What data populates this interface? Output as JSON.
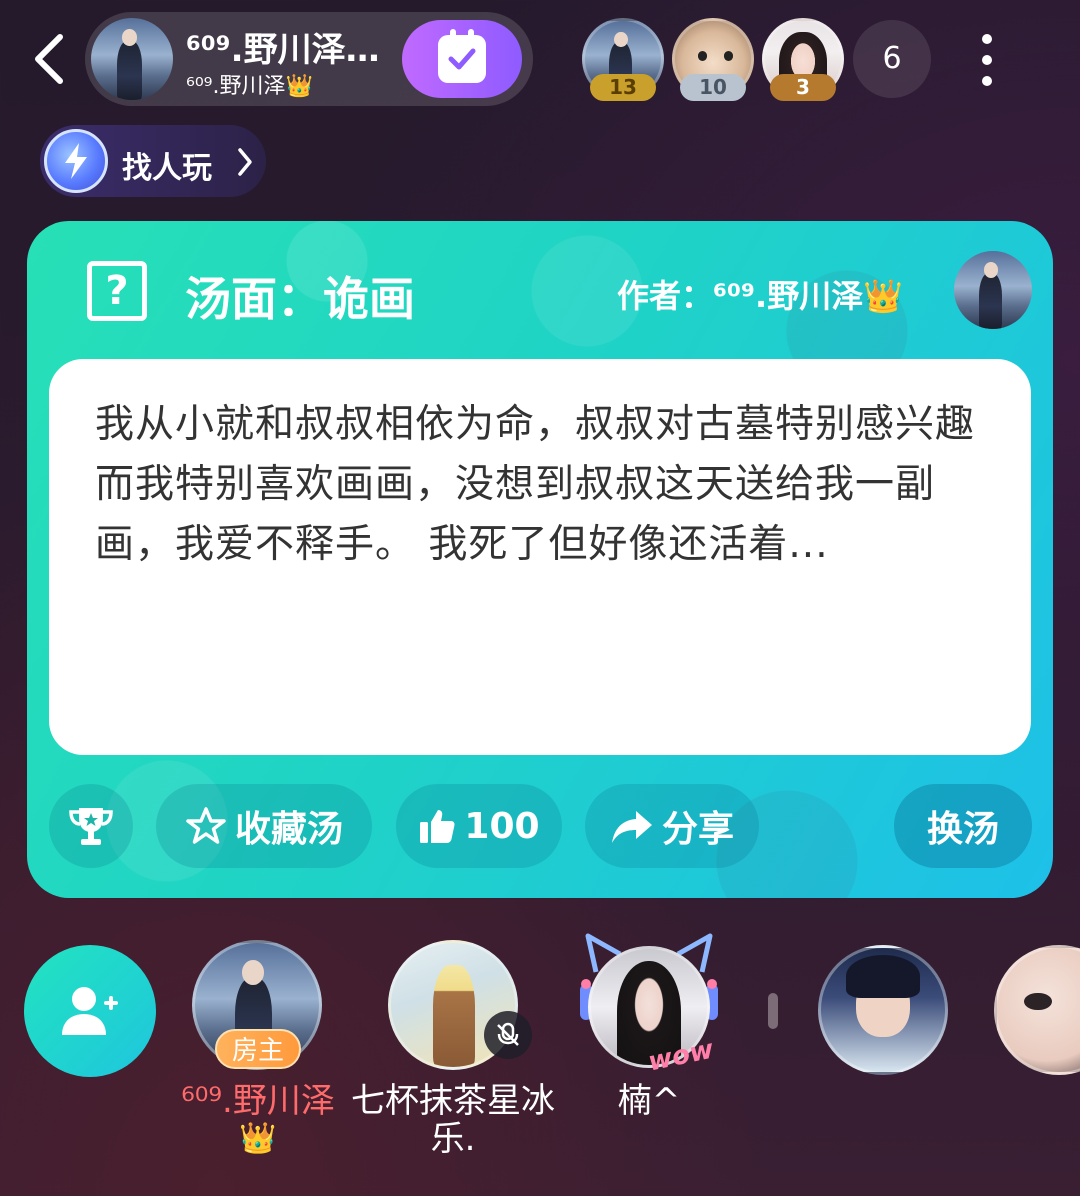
{
  "header": {
    "room_title": "⁶⁰⁹.野川泽…",
    "room_owner": "⁶⁰⁹.野川泽👑",
    "online_count": "6",
    "rank": [
      {
        "avatar": "man-avatar",
        "score": "13",
        "tier": "gold"
      },
      {
        "avatar": "hamster-avatar",
        "score": "10",
        "tier": "silver"
      },
      {
        "avatar": "girl-avatar",
        "score": "3",
        "tier": "bronze"
      }
    ]
  },
  "find_play": {
    "label": "找人玩"
  },
  "soup": {
    "title": "汤面：诡画",
    "author": "作者：⁶⁰⁹.野川泽👑",
    "text": "我从小就和叔叔相依为命，叔叔对古墓特别感兴趣 而我特别喜欢画画，没想到叔叔这天送给我一副画，我爱不释手。 我死了但好像还活着...",
    "actions": {
      "favorite": "收藏汤",
      "likes": "100",
      "share": "分享",
      "switch": "换汤"
    }
  },
  "seats": [
    {
      "name": "⁶⁰⁹.野川泽",
      "crown": "👑",
      "badge": "房主"
    },
    {
      "name": "七杯抹茶星冰乐.",
      "muted": true
    },
    {
      "name": "楠^",
      "decoration": "wow"
    },
    {
      "name": ""
    },
    {
      "name": ""
    }
  ],
  "colors": {
    "card_start": "#27e0b6",
    "card_end": "#1ec0e8",
    "checkin_start": "#c06aff",
    "checkin_end": "#8e5bff",
    "host_name": "#ff6b6b",
    "host_badge": "#ff9a3c"
  }
}
